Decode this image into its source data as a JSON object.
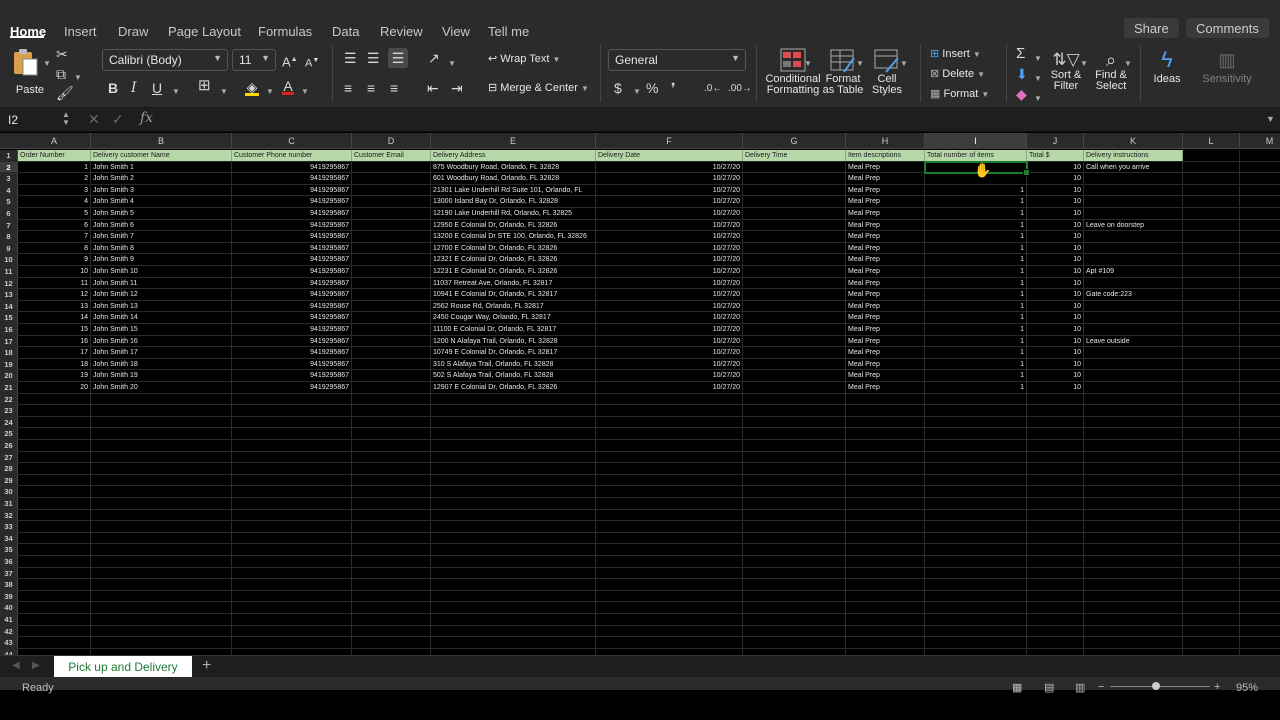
{
  "ribbon_tabs": [
    "Home",
    "Insert",
    "Draw",
    "Page Layout",
    "Formulas",
    "Data",
    "Review",
    "View",
    "Tell me"
  ],
  "top_buttons": {
    "share": "Share",
    "comments": "Comments"
  },
  "clipboard": {
    "paste": "Paste"
  },
  "font": {
    "name": "Calibri (Body)",
    "size": "11"
  },
  "alignment": {
    "wrap_text": "Wrap Text",
    "merge_center": "Merge & Center"
  },
  "number": {
    "format": "General"
  },
  "styles": {
    "conditional": "Conditional",
    "formatting": "Formatting",
    "format_as": "Format",
    "as_table": "as Table",
    "cell": "Cell",
    "cell_styles": "Styles"
  },
  "cells": {
    "insert": "Insert",
    "delete": "Delete",
    "format": "Format"
  },
  "editing": {
    "sort": "Sort &",
    "filter": "Filter",
    "find": "Find &",
    "select": "Select"
  },
  "ideas": "Ideas",
  "sensitivity": "Sensitivity",
  "formula_bar": {
    "cell_ref": "I2",
    "fx": "fx",
    "formula": ""
  },
  "columns": [
    "A",
    "B",
    "C",
    "D",
    "E",
    "F",
    "G",
    "H",
    "I",
    "J",
    "K",
    "L",
    "M"
  ],
  "selected_column": "I",
  "selected_row": 2,
  "headers": [
    "Order Number",
    "Delivery customer Name",
    "Customer Phone number",
    "Customer Email",
    "Delivery Address",
    "Delivery Date",
    "Delivery Time",
    "Item descriptions",
    "Total number of items",
    "Total $",
    "Delivery instructions"
  ],
  "rows": [
    [
      "1",
      "John Smith 1",
      "9419295867",
      "",
      "875 Woodbury Road, Orlando, FL 32828",
      "10/27/20",
      "",
      "Meal Prep",
      "",
      "10",
      "Call when you arrive"
    ],
    [
      "2",
      "John Smith 2",
      "9419295867",
      "",
      "601 Woodbury Road, Orlando, FL 32828",
      "10/27/20",
      "",
      "Meal Prep",
      "",
      "10",
      ""
    ],
    [
      "3",
      "John Smith 3",
      "9419295867",
      "",
      "21301 Lake Underhill Rd Suite 101, Orlando, FL",
      "10/27/20",
      "",
      "Meal Prep",
      "1",
      "10",
      ""
    ],
    [
      "4",
      "John Smith 4",
      "9419295867",
      "",
      "13000 Island Bay Dr, Orlando, FL 32828",
      "10/27/20",
      "",
      "Meal Prep",
      "1",
      "10",
      ""
    ],
    [
      "5",
      "John Smith 5",
      "9419295867",
      "",
      "12190 Lake Underhill Rd, Orlando, FL 32825",
      "10/27/20",
      "",
      "Meal Prep",
      "1",
      "10",
      ""
    ],
    [
      "6",
      "John Smith 6",
      "9419295867",
      "",
      "12950 E Colonial Dr, Orlando, FL 32826",
      "10/27/20",
      "",
      "Meal Prep",
      "1",
      "10",
      "Leave on doorstep"
    ],
    [
      "7",
      "John Smith 7",
      "9419295867",
      "",
      "13200 E Colonial Dr STE 100, Orlando, FL 32826",
      "10/27/20",
      "",
      "Meal Prep",
      "1",
      "10",
      ""
    ],
    [
      "8",
      "John Smith 8",
      "9419295867",
      "",
      "12700 E Colonial Dr, Orlando, FL 32826",
      "10/27/20",
      "",
      "Meal Prep",
      "1",
      "10",
      ""
    ],
    [
      "9",
      "John Smith 9",
      "9419295867",
      "",
      "12321 E Colonial Dr, Orlando, FL 32826",
      "10/27/20",
      "",
      "Meal Prep",
      "1",
      "10",
      ""
    ],
    [
      "10",
      "John Smith 10",
      "9419295867",
      "",
      "12231 E Colonial Dr, Orlando, FL 32826",
      "10/27/20",
      "",
      "Meal Prep",
      "1",
      "10",
      "Apt #109"
    ],
    [
      "11",
      "John Smith 11",
      "9419295867",
      "",
      "11037 Retreat Ave, Orlando, FL 32817",
      "10/27/20",
      "",
      "Meal Prep",
      "1",
      "10",
      ""
    ],
    [
      "12",
      "John Smith 12",
      "9419295867",
      "",
      "10941 E Colonial Dr, Orlando, FL 32817",
      "10/27/20",
      "",
      "Meal Prep",
      "1",
      "10",
      "Gate code:223"
    ],
    [
      "13",
      "John Smith 13",
      "9419295867",
      "",
      "2562 Rouse Rd, Orlando, FL 32817",
      "10/27/20",
      "",
      "Meal Prep",
      "1",
      "10",
      ""
    ],
    [
      "14",
      "John Smith 14",
      "9419295867",
      "",
      "2450 Cougar Way, Orlando, FL 32817",
      "10/27/20",
      "",
      "Meal Prep",
      "1",
      "10",
      ""
    ],
    [
      "15",
      "John Smith 15",
      "9419295867",
      "",
      "11100 E Colonial Dr, Orlando, FL 32817",
      "10/27/20",
      "",
      "Meal Prep",
      "1",
      "10",
      ""
    ],
    [
      "16",
      "John Smith 16",
      "9419295867",
      "",
      "1200 N Alafaya Trail, Orlando, FL 32828",
      "10/27/20",
      "",
      "Meal Prep",
      "1",
      "10",
      "Leave outside"
    ],
    [
      "17",
      "John Smith 17",
      "9419295867",
      "",
      "10749 E Colonial Dr, Orlando, FL 32817",
      "10/27/20",
      "",
      "Meal Prep",
      "1",
      "10",
      ""
    ],
    [
      "18",
      "John Smith 18",
      "9419295867",
      "",
      "310 S Alafaya Trail, Orlando, FL 32828",
      "10/27/20",
      "",
      "Meal Prep",
      "1",
      "10",
      ""
    ],
    [
      "19",
      "John Smith 19",
      "9419295867",
      "",
      "502 S Alafaya Trail, Orlando, FL 32828",
      "10/27/20",
      "",
      "Meal Prep",
      "1",
      "10",
      ""
    ],
    [
      "20",
      "John Smith 20",
      "9419295867",
      "",
      "12907 E Colonial Dr, Orlando, FL 32826",
      "10/27/20",
      "",
      "Meal Prep",
      "1",
      "10",
      ""
    ]
  ],
  "numeric_columns": [
    0,
    2,
    5,
    8,
    9
  ],
  "total_rows": 44,
  "sheet_tab": "Pick up and Delivery",
  "add_sheet": "+",
  "status": "Ready",
  "zoom": "95%",
  "colors": {
    "header_fill": "#b6d7a8",
    "selection": "#1e7b34",
    "sheet_tab_text": "#1e7b34"
  }
}
